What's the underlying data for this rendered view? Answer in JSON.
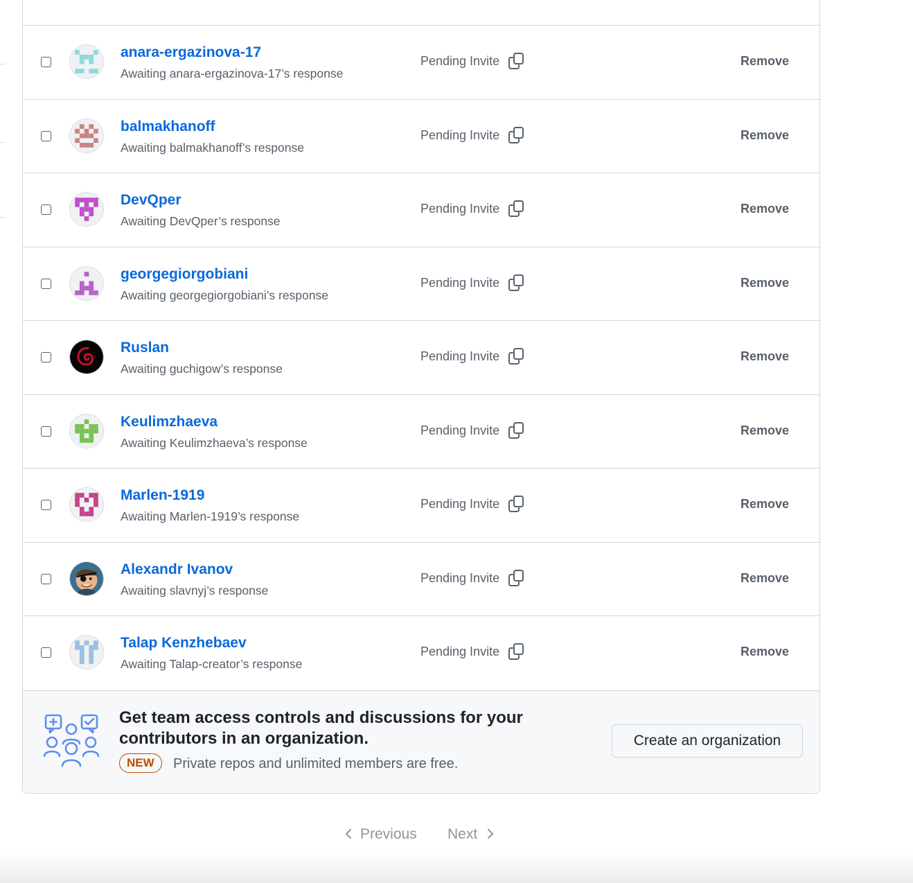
{
  "invites": [
    {
      "name": "anara-ergazinova-17",
      "subtitle": "Awaiting anara-ergazinova-17’s response",
      "status": "Pending Invite",
      "action": "Remove",
      "avatar": {
        "type": "identicon",
        "color": "#8fd8dc"
      }
    },
    {
      "name": "balmakhanoff",
      "subtitle": "Awaiting balmakhanoff’s response",
      "status": "Pending Invite",
      "action": "Remove",
      "avatar": {
        "type": "identicon",
        "color": "#c98484"
      }
    },
    {
      "name": "DevQper",
      "subtitle": "Awaiting DevQper’s response",
      "status": "Pending Invite",
      "action": "Remove",
      "avatar": {
        "type": "identicon",
        "color": "#c04fcc"
      }
    },
    {
      "name": "georgegiorgobiani",
      "subtitle": "Awaiting georgegiorgobiani’s response",
      "status": "Pending Invite",
      "action": "Remove",
      "avatar": {
        "type": "identicon",
        "color": "#b761c9"
      }
    },
    {
      "name": "Ruslan",
      "subtitle": "Awaiting guchigow’s response",
      "status": "Pending Invite",
      "action": "Remove",
      "avatar": {
        "type": "photo-swirl",
        "color": "#c8102e"
      }
    },
    {
      "name": "Keulimzhaeva",
      "subtitle": "Awaiting Keulimzhaeva’s response",
      "status": "Pending Invite",
      "action": "Remove",
      "avatar": {
        "type": "identicon",
        "color": "#7ac256"
      }
    },
    {
      "name": "Marlen-1919",
      "subtitle": "Awaiting Marlen-1919’s response",
      "status": "Pending Invite",
      "action": "Remove",
      "avatar": {
        "type": "identicon",
        "color": "#c2448a"
      }
    },
    {
      "name": "Alexandr Ivanov",
      "subtitle": "Awaiting slavnyj’s response",
      "status": "Pending Invite",
      "action": "Remove",
      "avatar": {
        "type": "photo-pirate",
        "color": "#3b6e8f"
      }
    },
    {
      "name": "Talap Kenzhebaev",
      "subtitle": "Awaiting Talap-creator’s response",
      "status": "Pending Invite",
      "action": "Remove",
      "avatar": {
        "type": "identicon",
        "color": "#9bbfe0"
      }
    }
  ],
  "promo": {
    "headline": "Get team access controls and discussions for your contributors in an organization.",
    "badge": "NEW",
    "note": "Private repos and unlimited members are free.",
    "cta": "Create an organization",
    "icon": "team-discussion-illustration"
  },
  "pagination": {
    "previous": "Previous",
    "next": "Next"
  },
  "colors": {
    "link": "#0969da",
    "muted": "#57606a",
    "border": "#d0d7de",
    "badge": "#bc4c00"
  }
}
